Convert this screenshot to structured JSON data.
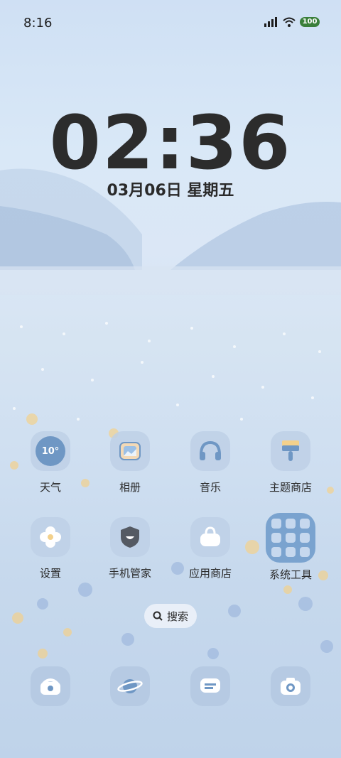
{
  "status_bar": {
    "time": "8:16",
    "battery": "100"
  },
  "lock_clock": {
    "time": "02:36",
    "date": "03月06日 星期五"
  },
  "weather_temp": "10°",
  "apps": [
    {
      "label": "天气",
      "icon": "weather-icon"
    },
    {
      "label": "相册",
      "icon": "gallery-icon"
    },
    {
      "label": "音乐",
      "icon": "headphones-icon"
    },
    {
      "label": "主题商店",
      "icon": "paint-brush-icon"
    },
    {
      "label": "设置",
      "icon": "flower-gear-icon"
    },
    {
      "label": "手机管家",
      "icon": "shield-icon"
    },
    {
      "label": "应用商店",
      "icon": "shopping-bag-icon"
    },
    {
      "label": "系统工具",
      "icon": "folder-icon"
    }
  ],
  "search": {
    "label": "搜索"
  },
  "dock": [
    {
      "icon": "phone-icon"
    },
    {
      "icon": "browser-planet-icon"
    },
    {
      "icon": "messages-icon"
    },
    {
      "icon": "camera-icon"
    }
  ],
  "colors": {
    "accent": "#6f97c4",
    "icon_bg": "#bed0e6",
    "text": "#2a2a2a"
  }
}
